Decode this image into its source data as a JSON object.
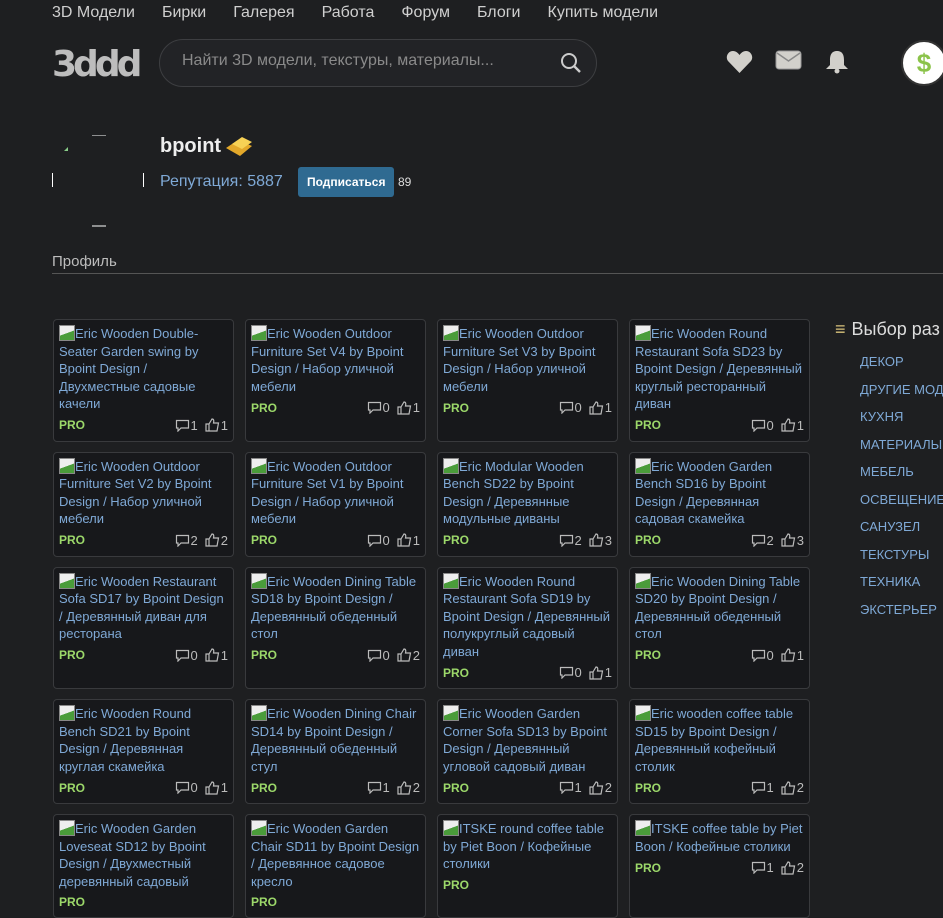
{
  "nav": [
    "3D Модели",
    "Бирки",
    "Галерея",
    "Работа",
    "Форум",
    "Блоги",
    "Купить модели"
  ],
  "logo": "3ddd",
  "search": {
    "placeholder": "Найти 3D модели, текстуры, материалы..."
  },
  "header_icons": [
    "heart-icon",
    "mail-icon",
    "bell-icon"
  ],
  "balance_symbol": "$",
  "profile": {
    "username": "bpoint",
    "reputation": "Репутация: 5887",
    "subscribe": "Подписаться",
    "subscribers": "89",
    "tab": "Профиль"
  },
  "colors": {
    "accent": "#2f6a91",
    "link": "#7fa9d6",
    "pro": "#9cd86a",
    "background": "#1e1f21"
  },
  "models": [
    {
      "title": "Eric Wooden Double-Seater Garden swing by Bpoint Design / Двухместные садовые качели",
      "badge": "PRO",
      "comments": "1",
      "likes": "1"
    },
    {
      "title": "Eric Wooden Outdoor Furniture Set V4 by Bpoint Design / Набор уличной мебели",
      "badge": "PRO",
      "comments": "0",
      "likes": "1"
    },
    {
      "title": "Eric Wooden Outdoor Furniture Set V3 by Bpoint Design / Набор уличной мебели",
      "badge": "PRO",
      "comments": "0",
      "likes": "1"
    },
    {
      "title": "Eric Wooden Round Restaurant Sofa SD23 by Bpoint Design / Деревянный круглый ресторанный диван",
      "badge": "PRO",
      "comments": "0",
      "likes": "1"
    },
    {
      "title": "Eric Wooden Outdoor Furniture Set V2 by Bpoint Design / Набор уличной мебели",
      "badge": "PRO",
      "comments": "2",
      "likes": "2"
    },
    {
      "title": "Eric Wooden Outdoor Furniture Set V1 by Bpoint Design / Набор уличной мебели",
      "badge": "PRO",
      "comments": "0",
      "likes": "1"
    },
    {
      "title": "Eric Modular Wooden Bench SD22 by Bpoint Design / Деревянные модульные диваны",
      "badge": "PRO",
      "comments": "2",
      "likes": "3"
    },
    {
      "title": "Eric Wooden Garden Bench SD16 by Bpoint Design / Деревянная садовая скамейка",
      "badge": "PRO",
      "comments": "2",
      "likes": "3"
    },
    {
      "title": "Eric Wooden Restaurant Sofa SD17 by Bpoint Design / Деревянный диван для ресторана",
      "badge": "PRO",
      "comments": "0",
      "likes": "1"
    },
    {
      "title": "Eric Wooden Dining Table SD18 by Bpoint Design / Деревянный обеденный стол",
      "badge": "PRO",
      "comments": "0",
      "likes": "2"
    },
    {
      "title": "Eric Wooden Round Restaurant Sofa SD19 by Bpoint Design / Деревянный полукруглый садовый диван",
      "badge": "PRO",
      "comments": "0",
      "likes": "1"
    },
    {
      "title": "Eric Wooden Dining Table SD20 by Bpoint Design / Деревянный обеденный стол",
      "badge": "PRO",
      "comments": "0",
      "likes": "1"
    },
    {
      "title": "Eric Wooden Round Bench SD21 by Bpoint Design / Деревянная круглая скамейка",
      "badge": "PRO",
      "comments": "0",
      "likes": "1"
    },
    {
      "title": "Eric Wooden Dining Chair SD14 by Bpoint Design / Деревянный обеденный стул",
      "badge": "PRO",
      "comments": "1",
      "likes": "2"
    },
    {
      "title": "Eric Wooden Garden Corner Sofa SD13 by Bpoint Design / Деревянный угловой садовый диван",
      "badge": "PRO",
      "comments": "1",
      "likes": "2"
    },
    {
      "title": "Eric wooden coffee table SD15 by Bpoint Design / Деревянный кофейный столик",
      "badge": "PRO",
      "comments": "1",
      "likes": "2"
    },
    {
      "title": "Eric Wooden Garden Loveseat SD12 by Bpoint Design / Двухместный деревянный садовый",
      "badge": "PRO"
    },
    {
      "title": "Eric Wooden Garden Chair SD11 by Bpoint Design / Деревянное садовое кресло",
      "badge": "PRO"
    },
    {
      "title": "ITSKE round coffee table by Piet Boon / Кофейные столики",
      "badge": "PRO"
    },
    {
      "title": "ITSKE coffee table by Piet Boon / Кофейные столики",
      "badge": "PRO",
      "comments": "1",
      "likes": "2"
    }
  ],
  "sidebar": {
    "title": "Выбор раз",
    "items": [
      "ДЕКОР",
      "ДРУГИЕ МОД",
      "КУХНЯ",
      "МАТЕРИАЛЫ",
      "МЕБЕЛЬ",
      "ОСВЕЩЕНИЕ",
      "САНУЗЕЛ",
      "ТЕКСТУРЫ",
      "ТЕХНИКА",
      "ЭКСТЕРЬЕР"
    ]
  }
}
